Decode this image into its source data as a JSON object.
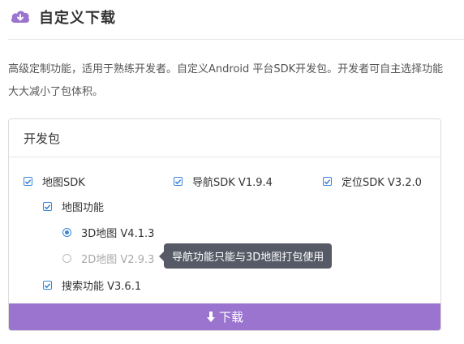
{
  "header": {
    "title": "自定义下载",
    "icon": "cloud-download-icon",
    "accent_color": "#9b74d0"
  },
  "description": {
    "line1": "高级定制功能，适用于熟练开发者。自定义Android 平台SDK开发包。开发者可自主选择功能",
    "line2": "大大减小了包体积。"
  },
  "panel": {
    "title": "开发包",
    "sdks": [
      {
        "label": "地图SDK",
        "checked": true
      },
      {
        "label": "导航SDK V1.9.4",
        "checked": true
      },
      {
        "label": "定位SDK V3.2.0",
        "checked": true
      }
    ],
    "map_feature": {
      "label": "地图功能",
      "checked": true
    },
    "map_versions": [
      {
        "label": "3D地图 V4.1.3",
        "selected": true,
        "disabled": false
      },
      {
        "label": "2D地图 V2.9.3",
        "selected": false,
        "disabled": true
      }
    ],
    "search_feature": {
      "label": "搜索功能 V3.6.1",
      "checked": true
    },
    "tooltip": "导航功能只能与3D地图打包使用",
    "download_label": "下载",
    "checkbox_color": "#3a86d8"
  }
}
